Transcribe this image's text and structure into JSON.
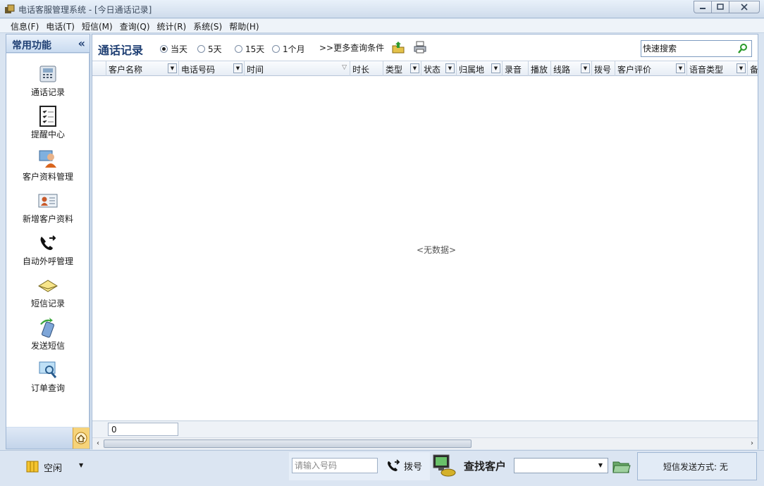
{
  "window": {
    "title": "电话客服管理系统 - [今日通话记录]",
    "buttons": [
      "minimize",
      "restore",
      "close"
    ]
  },
  "menu": [
    {
      "label": "信息(F)"
    },
    {
      "label": "电话(T)"
    },
    {
      "label": "短信(M)"
    },
    {
      "label": "查询(Q)"
    },
    {
      "label": "统计(R)"
    },
    {
      "label": "系统(S)"
    },
    {
      "label": "帮助(H)"
    }
  ],
  "sidebar": {
    "title": "常用功能",
    "collapse_icon": "«",
    "items": [
      {
        "label": "通话记录",
        "icon": "phone-icon"
      },
      {
        "label": "提醒中心",
        "icon": "checklist-icon"
      },
      {
        "label": "客户资料管理",
        "icon": "customer-icon"
      },
      {
        "label": "新增客户资料",
        "icon": "id-card-icon"
      },
      {
        "label": "自动外呼管理",
        "icon": "callout-icon"
      },
      {
        "label": "短信记录",
        "icon": "sms-record-icon"
      },
      {
        "label": "发送短信",
        "icon": "send-sms-icon"
      },
      {
        "label": "订单查询",
        "icon": "order-search-icon"
      }
    ]
  },
  "toolbar": {
    "title": "通话记录",
    "ranges": [
      {
        "label": "当天",
        "selected": true
      },
      {
        "label": "5天",
        "selected": false
      },
      {
        "label": "15天",
        "selected": false
      },
      {
        "label": "1个月",
        "selected": false
      }
    ],
    "more_conditions": ">>更多查询条件",
    "search_placeholder": "快速搜索"
  },
  "grid": {
    "columns": [
      {
        "label": "客户名称",
        "dropdown": true
      },
      {
        "label": "电话号码",
        "dropdown": true
      },
      {
        "label": "时间",
        "dropdown": false,
        "sorted": true
      },
      {
        "label": "时长",
        "dropdown": false
      },
      {
        "label": "类型",
        "dropdown": true
      },
      {
        "label": "状态",
        "dropdown": true
      },
      {
        "label": "归属地",
        "dropdown": true
      },
      {
        "label": "录音",
        "dropdown": false
      },
      {
        "label": "播放",
        "dropdown": false
      },
      {
        "label": "线路",
        "dropdown": true
      },
      {
        "label": "拨号",
        "dropdown": false
      },
      {
        "label": "客户评价",
        "dropdown": true
      },
      {
        "label": "语音类型",
        "dropdown": true
      },
      {
        "label": "备",
        "dropdown": false
      }
    ],
    "empty_text": "<无数据>",
    "row_count": "0"
  },
  "statusbar": {
    "state": "空闲",
    "phone_placeholder": "请输入号码",
    "dial_label": "拨号",
    "find_label": "查找客户",
    "sms_mode": "短信发送方式: 无"
  },
  "colors": {
    "accent": "#1f3f73",
    "frame": "#9fb6d3",
    "background": "#d9e4f1"
  }
}
